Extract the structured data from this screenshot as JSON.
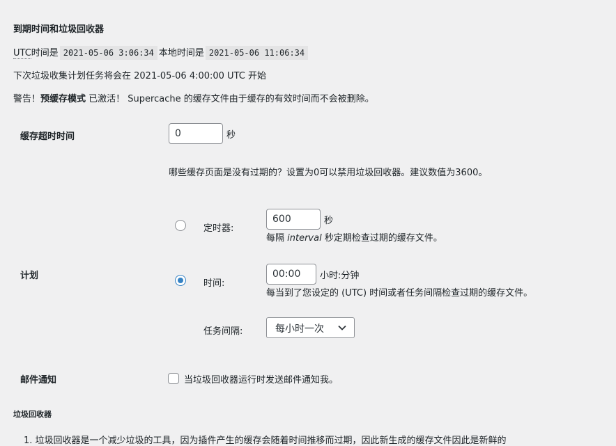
{
  "heading": "到期时间和垃圾回收器",
  "time_info": {
    "utc_label": "UTC",
    "utc_suffix": "时间是",
    "utc_time": "2021-05-06 3:06:34",
    "local_label": "本地时间是",
    "local_time": "2021-05-06 11:06:34"
  },
  "schedule_notice": "下次垃圾收集计划任务将会在 2021-05-06 4:00:00 UTC 开始",
  "warning": {
    "prefix": "警告！",
    "bold": "预缓存模式",
    "suffix": " 已激活！ Supercache 的缓存文件由于缓存的有效时间而不会被删除。"
  },
  "cache_timeout": {
    "label": "缓存超时时间",
    "value": "0",
    "unit": "秒",
    "help": "哪些缓存页面是没有过期的？设置为0可以禁用垃圾回收器。建议数值为3600。"
  },
  "schedule": {
    "label": "计划",
    "timer": {
      "label": "定时器:",
      "value": "600",
      "unit": "秒",
      "help_pre": "每隔 ",
      "help_em": "interval",
      "help_post": " 秒定期检查过期的缓存文件。",
      "checked": false
    },
    "clock": {
      "label": "时间:",
      "value": "00:00",
      "unit": "小时:分钟",
      "help": "每当到了您设定的 (UTC) 时间或者任务间隔检查过期的缓存文件。",
      "checked": true
    },
    "interval": {
      "label": "任务间隔:",
      "selected": "每小时一次"
    }
  },
  "email": {
    "label": "邮件通知",
    "checkbox_label": "当垃圾回收器运行时发送邮件通知我。",
    "checked": false
  },
  "gc_section": {
    "heading": "垃圾回收器",
    "list_item_1": "垃圾回收器是一个减少垃圾的工具，因为插件产生的缓存会随着时间推移而过期，因此新生成的缓存文件因此是新鲜的"
  }
}
